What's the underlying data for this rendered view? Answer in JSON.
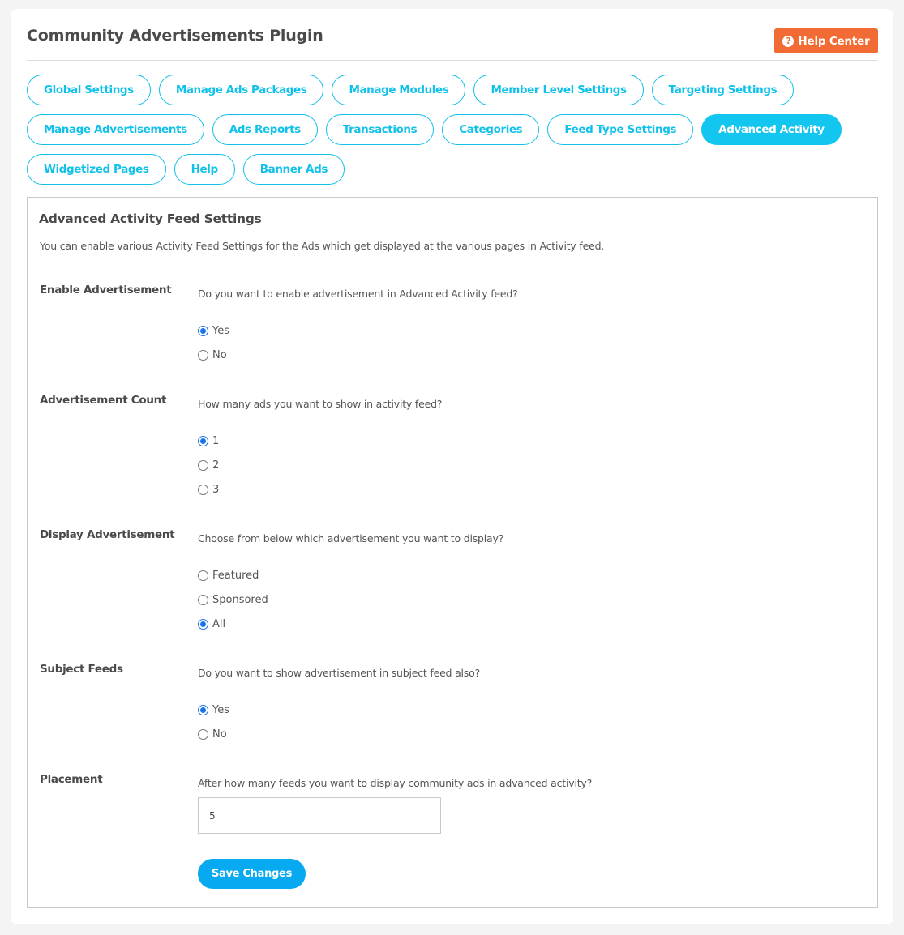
{
  "header": {
    "title": "Community Advertisements Plugin",
    "help_center": {
      "label": "Help Center",
      "icon": "question-circle-icon",
      "color": "#f26b35"
    }
  },
  "tabs": {
    "active": "Advanced Activity",
    "rows": [
      [
        "Global Settings",
        "Manage Ads Packages",
        "Manage Modules",
        "Member Level Settings",
        "Targeting Settings"
      ],
      [
        "Manage Advertisements",
        "Ads Reports",
        "Transactions",
        "Categories",
        "Feed Type Settings",
        "Advanced Activity"
      ],
      [
        "Widgetized Pages",
        "Help",
        "Banner Ads"
      ]
    ],
    "accent_color": "#12c1ea"
  },
  "panel": {
    "title": "Advanced Activity Feed Settings",
    "description": "You can enable various Activity Feed Settings for the Ads which get displayed at the various pages in Activity feed."
  },
  "fields": {
    "enable_ad": {
      "label": "Enable Advertisement",
      "question": "Do you want to enable advertisement in Advanced Activity feed?",
      "options": [
        "Yes",
        "No"
      ],
      "selected": "Yes"
    },
    "ad_count": {
      "label": "Advertisement Count",
      "question": "How many ads you want to show in activity feed?",
      "options": [
        "1",
        "2",
        "3"
      ],
      "selected": "1"
    },
    "display_ad": {
      "label": "Display Advertisement",
      "question": "Choose from below which advertisement you want to display?",
      "options": [
        "Featured",
        "Sponsored",
        "All"
      ],
      "selected": "All"
    },
    "subject_feeds": {
      "label": "Subject Feeds",
      "question": "Do you want to show advertisement in subject feed also?",
      "options": [
        "Yes",
        "No"
      ],
      "selected": "Yes"
    },
    "placement": {
      "label": "Placement",
      "question": "After how many feeds you want to display community ads in advanced activity?",
      "value": "5"
    }
  },
  "actions": {
    "save_label": "Save Changes",
    "save_color": "#07a9f0"
  }
}
